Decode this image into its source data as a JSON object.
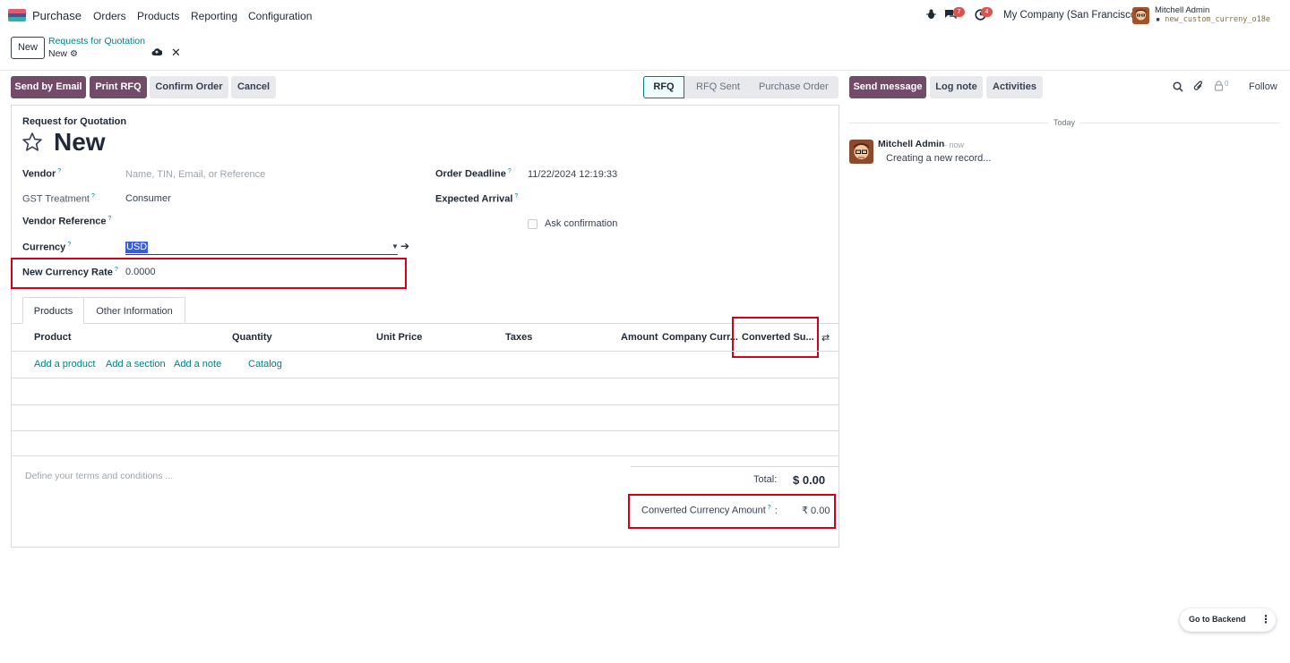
{
  "nav": {
    "app_name": "Purchase",
    "menu": [
      "Orders",
      "Products",
      "Reporting",
      "Configuration"
    ],
    "messages_badge": "7",
    "activities_badge": "4",
    "company": "My Company (San Francisco)",
    "user_name": "Mitchell Admin",
    "db_name": "new_custom_curreny_o18e"
  },
  "control_panel": {
    "new_label": "New",
    "breadcrumb": "Requests for Quotation",
    "record_name": "New"
  },
  "actions": {
    "send_email": "Send by Email",
    "print_rfq": "Print RFQ",
    "confirm_order": "Confirm Order",
    "cancel": "Cancel"
  },
  "statusbar": [
    "RFQ",
    "RFQ Sent",
    "Purchase Order"
  ],
  "form": {
    "doc_type": "Request for Quotation",
    "title": "New",
    "vendor_label": "Vendor",
    "vendor_placeholder": "Name, TIN, Email, or Reference",
    "gst_label": "GST Treatment",
    "gst_value": "Consumer",
    "vendor_ref_label": "Vendor Reference",
    "currency_label": "Currency",
    "currency_value": "USD",
    "rate_label": "New Currency Rate",
    "rate_value": "0.0000",
    "deadline_label": "Order Deadline",
    "deadline_value": "11/22/2024 12:19:33",
    "arrival_label": "Expected Arrival",
    "ask_confirmation": "Ask confirmation",
    "help_mark": "?"
  },
  "tabs": [
    "Products",
    "Other Information"
  ],
  "table": {
    "headers": [
      "Product",
      "Quantity",
      "Unit Price",
      "Taxes",
      "Amount",
      "Company Curr...",
      "Converted Su..."
    ],
    "add_product": "Add a product",
    "add_section": "Add a section",
    "add_note": "Add a note",
    "catalog": "Catalog"
  },
  "footer": {
    "terms_placeholder": "Define your terms and conditions ...",
    "total_label": "Total:",
    "total_value": "$ 0.00",
    "converted_label": "Converted Currency Amount",
    "converted_colon": ":",
    "converted_value": "₹ 0.00"
  },
  "chatter": {
    "send_message": "Send message",
    "log_note": "Log note",
    "activities": "Activities",
    "followers_count": "0",
    "follow": "Follow",
    "date_sep": "Today",
    "author": "Mitchell Admin",
    "time": "- now",
    "body": "Creating a new record..."
  },
  "backend_button": "Go to Backend",
  "colors": {
    "primary": "#714b67",
    "link": "#017e84",
    "highlight_box": "#d0021b"
  }
}
